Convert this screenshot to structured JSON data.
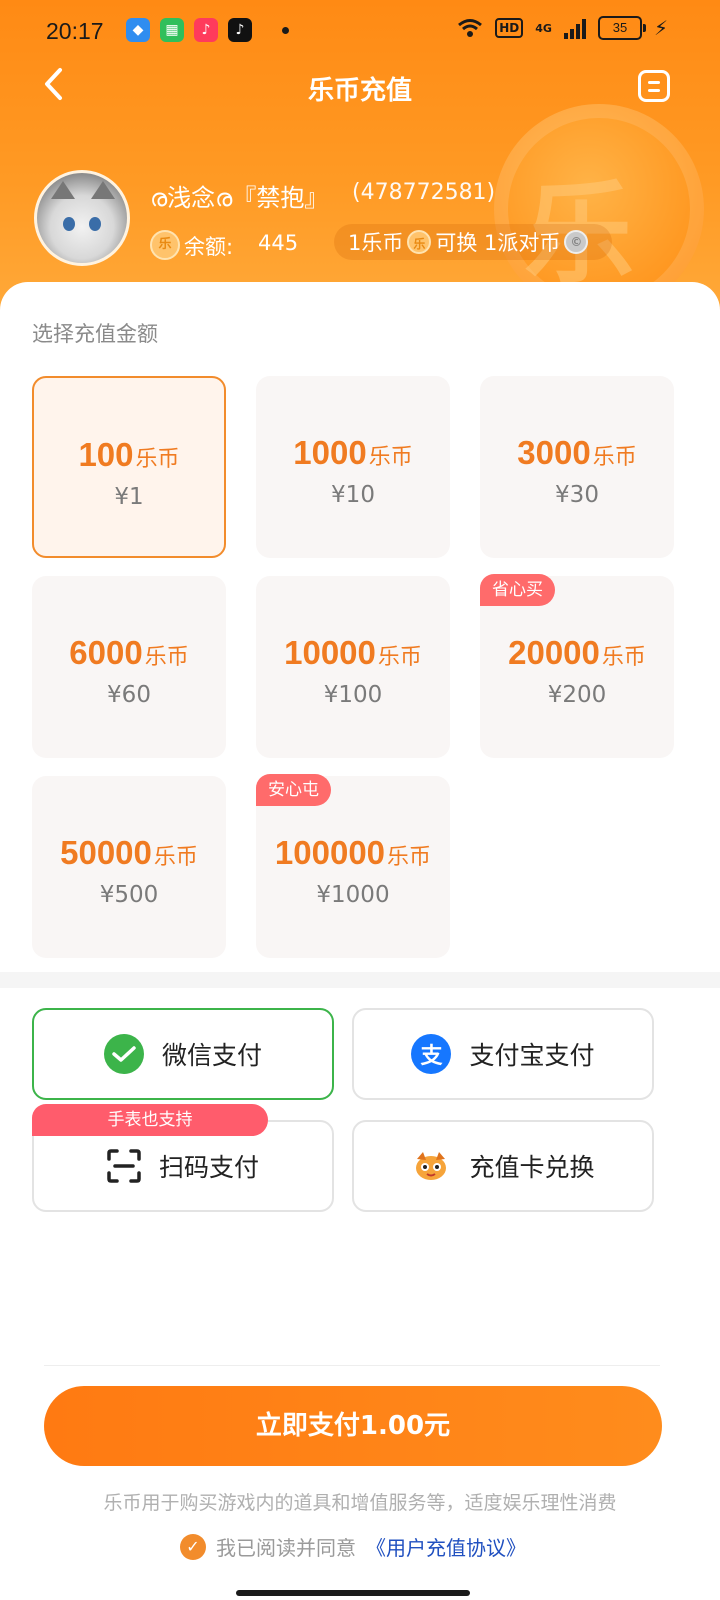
{
  "status": {
    "time": "20:17",
    "network": "4G",
    "hd": "HD",
    "battery": "35"
  },
  "header": {
    "title": "乐币充值",
    "bg_coin_char": "乐"
  },
  "user": {
    "name": "ര浅念ര『禁抱』",
    "id": "(478772581)",
    "balance_label": "余额:",
    "balance_value": "445",
    "coin_char": "乐",
    "rate_left": "1乐币",
    "rate_mid": "可换 1派对币"
  },
  "section_title": "选择充值金额",
  "amounts": [
    {
      "coins": "100",
      "unit": "乐币",
      "price": "¥1",
      "tag": "",
      "selected": true
    },
    {
      "coins": "1000",
      "unit": "乐币",
      "price": "¥10",
      "tag": "",
      "selected": false
    },
    {
      "coins": "3000",
      "unit": "乐币",
      "price": "¥30",
      "tag": "",
      "selected": false
    },
    {
      "coins": "6000",
      "unit": "乐币",
      "price": "¥60",
      "tag": "",
      "selected": false
    },
    {
      "coins": "10000",
      "unit": "乐币",
      "price": "¥100",
      "tag": "",
      "selected": false
    },
    {
      "coins": "20000",
      "unit": "乐币",
      "price": "¥200",
      "tag": "省心买",
      "selected": false
    },
    {
      "coins": "50000",
      "unit": "乐币",
      "price": "¥500",
      "tag": "",
      "selected": false
    },
    {
      "coins": "100000",
      "unit": "乐币",
      "price": "¥1000",
      "tag": "安心屯",
      "selected": false
    }
  ],
  "payment": {
    "wechat": "微信支付",
    "alipay": "支付宝支付",
    "scan": "扫码支付",
    "scan_tag": "手表也支持",
    "card": "充值卡兑换",
    "alipay_char": "支"
  },
  "pay_now": "立即支付1.00元",
  "disclaimer": "乐币用于购买游戏内的道具和增值服务等，适度娱乐理性消费",
  "agree_text": "我已阅读并同意",
  "agree_link": "《用户充值协议》",
  "colors": {
    "primary": "#ff8a14",
    "selected_border": "#f28c2c",
    "wechat_green": "#3cb44a",
    "alipay_blue": "#1677ff",
    "tag_red": "#ff6b6b"
  }
}
